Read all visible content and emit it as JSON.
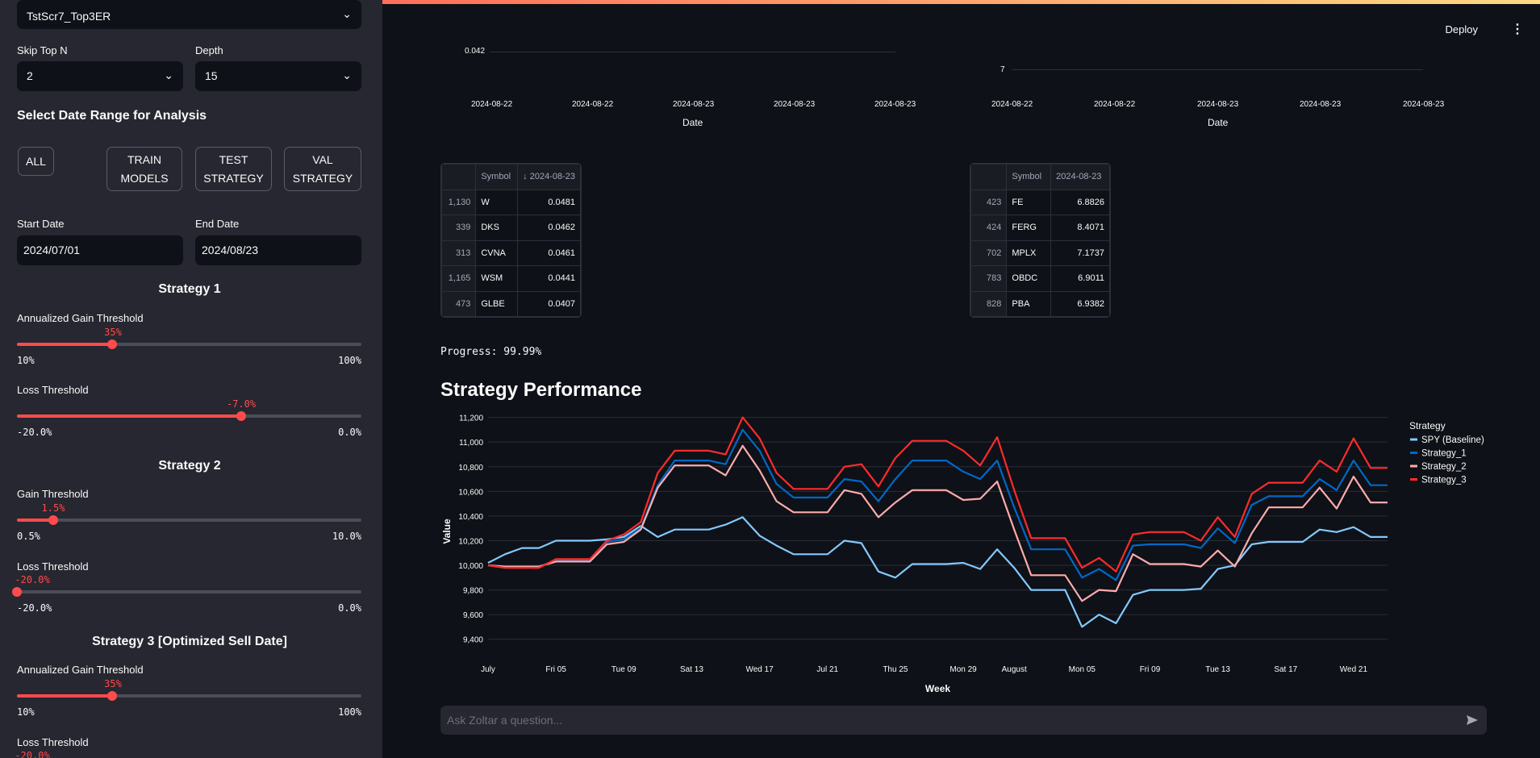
{
  "sidebar": {
    "model_select": "TstScr7_Top3ER",
    "skip_top_n": {
      "label": "Skip Top N",
      "value": "2"
    },
    "depth": {
      "label": "Depth",
      "value": "15"
    },
    "date_range_heading": "Select Date Range for Analysis",
    "buttons": {
      "all": "ALL",
      "train": "TRAIN MODELS",
      "test": "TEST STRATEGY",
      "val": "VAL STRATEGY"
    },
    "start_date": {
      "label": "Start Date",
      "value": "2024/07/01"
    },
    "end_date": {
      "label": "End Date",
      "value": "2024/08/23"
    },
    "strategy1": {
      "title": "Strategy 1",
      "gain": {
        "label": "Annualized Gain Threshold",
        "value": "35%",
        "min": "10%",
        "max": "100%",
        "fraction": 0.2778
      },
      "loss": {
        "label": "Loss Threshold",
        "value": "-7.0%",
        "min": "-20.0%",
        "max": "0.0%",
        "fraction": 0.65
      }
    },
    "strategy2": {
      "title": "Strategy 2",
      "gain": {
        "label": "Gain Threshold",
        "value": "1.5%",
        "min": "0.5%",
        "max": "10.0%",
        "fraction": 0.105
      },
      "loss": {
        "label": "Loss Threshold",
        "value": "-20.0%",
        "min": "-20.0%",
        "max": "0.0%",
        "fraction": 0.0
      }
    },
    "strategy3": {
      "title": "Strategy 3 [Optimized Sell Date]",
      "gain": {
        "label": "Annualized Gain Threshold",
        "value": "35%",
        "min": "10%",
        "max": "100%",
        "fraction": 0.2778
      },
      "loss": {
        "label": "Loss Threshold",
        "value": "-20.0%"
      }
    }
  },
  "header": {
    "deploy": "Deploy",
    "menu_icon": "vertical-dots-icon"
  },
  "top_charts": {
    "left": {
      "ytick": "0.042",
      "xticks": [
        "2024-08-22",
        "2024-08-22",
        "2024-08-23",
        "2024-08-23",
        "2024-08-23"
      ],
      "xlabel": "Date"
    },
    "right": {
      "ytick": "7",
      "xticks": [
        "2024-08-22",
        "2024-08-22",
        "2024-08-23",
        "2024-08-23",
        "2024-08-23"
      ],
      "xlabel": "Date"
    }
  },
  "table_left": {
    "headers": [
      "",
      "Symbol",
      "↓ 2024-08-23"
    ],
    "rows": [
      [
        "1,130",
        "W",
        "0.0481"
      ],
      [
        "339",
        "DKS",
        "0.0462"
      ],
      [
        "313",
        "CVNA",
        "0.0461"
      ],
      [
        "1,165",
        "WSM",
        "0.0441"
      ],
      [
        "473",
        "GLBE",
        "0.0407"
      ]
    ]
  },
  "table_right": {
    "headers": [
      "",
      "Symbol",
      "2024-08-23"
    ],
    "rows": [
      [
        "423",
        "FE",
        "6.8826"
      ],
      [
        "424",
        "FERG",
        "8.4071"
      ],
      [
        "702",
        "MPLX",
        "7.1737"
      ],
      [
        "783",
        "OBDC",
        "6.9011"
      ],
      [
        "828",
        "PBA",
        "6.9382"
      ]
    ]
  },
  "progress": "Progress: 99.99%",
  "perf_title": "Strategy Performance",
  "chat": {
    "placeholder": "Ask Zoltar a question..."
  },
  "chart_data": {
    "type": "line",
    "xlabel": "Week",
    "ylabel": "Value",
    "ylim": [
      9300,
      11250
    ],
    "yticks": [
      9400,
      9600,
      9800,
      10000,
      10200,
      10400,
      10600,
      10800,
      11000,
      11200
    ],
    "ytick_labels": [
      "9,400",
      "9,600",
      "9,800",
      "10,000",
      "10,200",
      "10,400",
      "10,600",
      "10,800",
      "11,000",
      "11,200"
    ],
    "xticks": [
      {
        "i": 0,
        "label": "July"
      },
      {
        "i": 4,
        "label": "Fri 05"
      },
      {
        "i": 8,
        "label": "Tue 09"
      },
      {
        "i": 12,
        "label": "Sat 13"
      },
      {
        "i": 16,
        "label": "Wed 17"
      },
      {
        "i": 20,
        "label": "Jul 21"
      },
      {
        "i": 24,
        "label": "Thu 25"
      },
      {
        "i": 28,
        "label": "Mon 29"
      },
      {
        "i": 31,
        "label": "August"
      },
      {
        "i": 35,
        "label": "Mon 05"
      },
      {
        "i": 39,
        "label": "Fri 09"
      },
      {
        "i": 43,
        "label": "Tue 13"
      },
      {
        "i": 47,
        "label": "Sat 17"
      },
      {
        "i": 51,
        "label": "Wed 21"
      }
    ],
    "x_count": 54,
    "legend_title": "Strategy",
    "legend_position": "right",
    "series": [
      {
        "name": "SPY (Baseline)",
        "color": "#83c9ff",
        "values": [
          10020,
          10090,
          10140,
          10140,
          10200,
          10200,
          10200,
          10210,
          10230,
          10320,
          10230,
          10290,
          10290,
          10290,
          10330,
          10390,
          10240,
          10160,
          10090,
          10090,
          10090,
          10200,
          10180,
          9950,
          9900,
          10010,
          10010,
          10010,
          10020,
          9970,
          10130,
          9980,
          9800,
          9800,
          9800,
          9500,
          9600,
          9530,
          9760,
          9800,
          9800,
          9800,
          9810,
          9970,
          10000,
          10170,
          10190,
          10190,
          10190,
          10290,
          10270,
          10310,
          10230,
          10230
        ]
      },
      {
        "name": "Strategy_1",
        "color": "#0068c9",
        "values": [
          10000,
          9990,
          9990,
          9990,
          10040,
          10040,
          10040,
          10190,
          10210,
          10300,
          10650,
          10850,
          10850,
          10850,
          10820,
          11100,
          10930,
          10660,
          10550,
          10550,
          10550,
          10700,
          10680,
          10520,
          10700,
          10850,
          10850,
          10850,
          10760,
          10700,
          10850,
          10470,
          10130,
          10130,
          10130,
          9900,
          9970,
          9880,
          10160,
          10170,
          10170,
          10170,
          10140,
          10300,
          10180,
          10490,
          10560,
          10560,
          10560,
          10700,
          10610,
          10850,
          10650,
          10650
        ]
      },
      {
        "name": "Strategy_2",
        "color": "#ffabab",
        "values": [
          10000,
          9990,
          9990,
          9990,
          10030,
          10030,
          10030,
          10170,
          10190,
          10290,
          10630,
          10810,
          10810,
          10810,
          10730,
          10970,
          10770,
          10520,
          10430,
          10430,
          10430,
          10610,
          10580,
          10390,
          10510,
          10610,
          10610,
          10610,
          10530,
          10540,
          10680,
          10290,
          9920,
          9920,
          9920,
          9710,
          9800,
          9790,
          10090,
          10010,
          10010,
          10010,
          9990,
          10120,
          9990,
          10260,
          10470,
          10470,
          10470,
          10630,
          10460,
          10720,
          10510,
          10510
        ]
      },
      {
        "name": "Strategy_3",
        "color": "#ff2b2b",
        "values": [
          10000,
          9980,
          9980,
          9980,
          10050,
          10050,
          10050,
          10200,
          10250,
          10350,
          10750,
          10930,
          10930,
          10930,
          10900,
          11200,
          11030,
          10750,
          10620,
          10620,
          10620,
          10800,
          10820,
          10640,
          10870,
          11010,
          11010,
          11010,
          10930,
          10810,
          11040,
          10610,
          10220,
          10220,
          10220,
          9980,
          10060,
          9950,
          10250,
          10270,
          10270,
          10270,
          10200,
          10390,
          10230,
          10580,
          10670,
          10670,
          10670,
          10850,
          10760,
          11030,
          10790,
          10790
        ]
      }
    ]
  }
}
